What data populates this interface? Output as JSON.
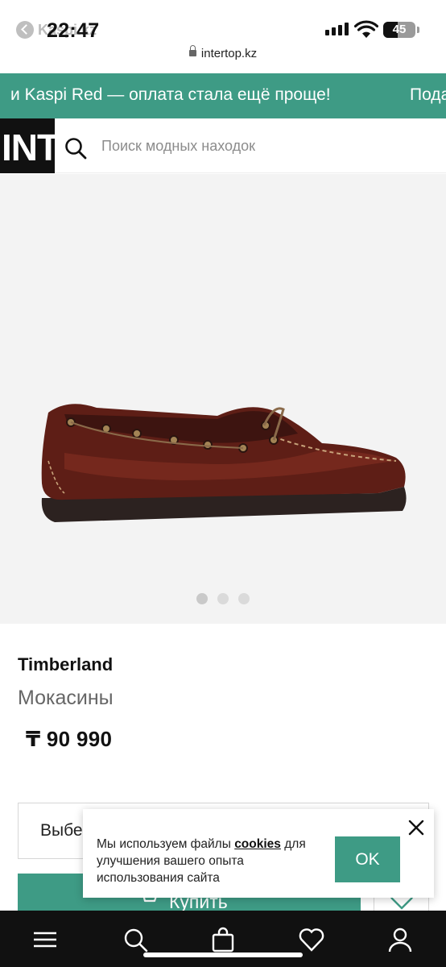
{
  "status_bar": {
    "back_app": "Kaspi.kz",
    "time": "22:47",
    "battery": "45",
    "battery_fraction": 0.45
  },
  "browser": {
    "url": "intertop.kz"
  },
  "promo": {
    "text": "и Kaspi Red — оплата стала ещё проще!",
    "next_text": "Пода"
  },
  "header": {
    "logo": "INTERTOP",
    "search_placeholder": "Поиск модных находок"
  },
  "gallery": {
    "image": "shoe-product-photo",
    "slide_count": 3,
    "active_slide": 1
  },
  "product": {
    "brand": "Timberland",
    "title": "Мокасины",
    "price": "₸ 90 990"
  },
  "actions": {
    "size_placeholder": "Выберите размер",
    "buy_label": "Купить"
  },
  "cookie": {
    "text_before": "Мы используем файлы ",
    "link": "cookies",
    "text_after": " для улучшения вашего опыта использования сайта",
    "ok_label": "OK"
  },
  "bottom_nav": {
    "items": [
      {
        "icon": "menu-icon"
      },
      {
        "icon": "search-icon"
      },
      {
        "icon": "bag-icon"
      },
      {
        "icon": "heart-icon"
      },
      {
        "icon": "user-icon"
      }
    ]
  },
  "colors": {
    "accent": "#3e9b85",
    "nav_bg": "#111111",
    "gallery_bg": "#f3f3f3"
  }
}
